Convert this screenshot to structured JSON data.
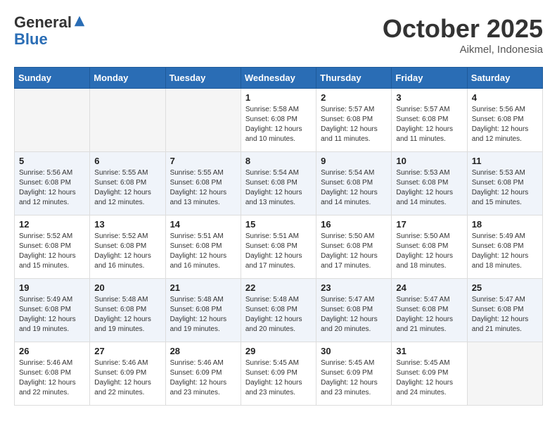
{
  "header": {
    "logo_general": "General",
    "logo_blue": "Blue",
    "month_title": "October 2025",
    "location": "Aikmel, Indonesia"
  },
  "weekdays": [
    "Sunday",
    "Monday",
    "Tuesday",
    "Wednesday",
    "Thursday",
    "Friday",
    "Saturday"
  ],
  "weeks": [
    [
      {
        "day": "",
        "info": ""
      },
      {
        "day": "",
        "info": ""
      },
      {
        "day": "",
        "info": ""
      },
      {
        "day": "1",
        "info": "Sunrise: 5:58 AM\nSunset: 6:08 PM\nDaylight: 12 hours and 10 minutes."
      },
      {
        "day": "2",
        "info": "Sunrise: 5:57 AM\nSunset: 6:08 PM\nDaylight: 12 hours and 11 minutes."
      },
      {
        "day": "3",
        "info": "Sunrise: 5:57 AM\nSunset: 6:08 PM\nDaylight: 12 hours and 11 minutes."
      },
      {
        "day": "4",
        "info": "Sunrise: 5:56 AM\nSunset: 6:08 PM\nDaylight: 12 hours and 12 minutes."
      }
    ],
    [
      {
        "day": "5",
        "info": "Sunrise: 5:56 AM\nSunset: 6:08 PM\nDaylight: 12 hours and 12 minutes."
      },
      {
        "day": "6",
        "info": "Sunrise: 5:55 AM\nSunset: 6:08 PM\nDaylight: 12 hours and 12 minutes."
      },
      {
        "day": "7",
        "info": "Sunrise: 5:55 AM\nSunset: 6:08 PM\nDaylight: 12 hours and 13 minutes."
      },
      {
        "day": "8",
        "info": "Sunrise: 5:54 AM\nSunset: 6:08 PM\nDaylight: 12 hours and 13 minutes."
      },
      {
        "day": "9",
        "info": "Sunrise: 5:54 AM\nSunset: 6:08 PM\nDaylight: 12 hours and 14 minutes."
      },
      {
        "day": "10",
        "info": "Sunrise: 5:53 AM\nSunset: 6:08 PM\nDaylight: 12 hours and 14 minutes."
      },
      {
        "day": "11",
        "info": "Sunrise: 5:53 AM\nSunset: 6:08 PM\nDaylight: 12 hours and 15 minutes."
      }
    ],
    [
      {
        "day": "12",
        "info": "Sunrise: 5:52 AM\nSunset: 6:08 PM\nDaylight: 12 hours and 15 minutes."
      },
      {
        "day": "13",
        "info": "Sunrise: 5:52 AM\nSunset: 6:08 PM\nDaylight: 12 hours and 16 minutes."
      },
      {
        "day": "14",
        "info": "Sunrise: 5:51 AM\nSunset: 6:08 PM\nDaylight: 12 hours and 16 minutes."
      },
      {
        "day": "15",
        "info": "Sunrise: 5:51 AM\nSunset: 6:08 PM\nDaylight: 12 hours and 17 minutes."
      },
      {
        "day": "16",
        "info": "Sunrise: 5:50 AM\nSunset: 6:08 PM\nDaylight: 12 hours and 17 minutes."
      },
      {
        "day": "17",
        "info": "Sunrise: 5:50 AM\nSunset: 6:08 PM\nDaylight: 12 hours and 18 minutes."
      },
      {
        "day": "18",
        "info": "Sunrise: 5:49 AM\nSunset: 6:08 PM\nDaylight: 12 hours and 18 minutes."
      }
    ],
    [
      {
        "day": "19",
        "info": "Sunrise: 5:49 AM\nSunset: 6:08 PM\nDaylight: 12 hours and 19 minutes."
      },
      {
        "day": "20",
        "info": "Sunrise: 5:48 AM\nSunset: 6:08 PM\nDaylight: 12 hours and 19 minutes."
      },
      {
        "day": "21",
        "info": "Sunrise: 5:48 AM\nSunset: 6:08 PM\nDaylight: 12 hours and 19 minutes."
      },
      {
        "day": "22",
        "info": "Sunrise: 5:48 AM\nSunset: 6:08 PM\nDaylight: 12 hours and 20 minutes."
      },
      {
        "day": "23",
        "info": "Sunrise: 5:47 AM\nSunset: 6:08 PM\nDaylight: 12 hours and 20 minutes."
      },
      {
        "day": "24",
        "info": "Sunrise: 5:47 AM\nSunset: 6:08 PM\nDaylight: 12 hours and 21 minutes."
      },
      {
        "day": "25",
        "info": "Sunrise: 5:47 AM\nSunset: 6:08 PM\nDaylight: 12 hours and 21 minutes."
      }
    ],
    [
      {
        "day": "26",
        "info": "Sunrise: 5:46 AM\nSunset: 6:08 PM\nDaylight: 12 hours and 22 minutes."
      },
      {
        "day": "27",
        "info": "Sunrise: 5:46 AM\nSunset: 6:09 PM\nDaylight: 12 hours and 22 minutes."
      },
      {
        "day": "28",
        "info": "Sunrise: 5:46 AM\nSunset: 6:09 PM\nDaylight: 12 hours and 23 minutes."
      },
      {
        "day": "29",
        "info": "Sunrise: 5:45 AM\nSunset: 6:09 PM\nDaylight: 12 hours and 23 minutes."
      },
      {
        "day": "30",
        "info": "Sunrise: 5:45 AM\nSunset: 6:09 PM\nDaylight: 12 hours and 23 minutes."
      },
      {
        "day": "31",
        "info": "Sunrise: 5:45 AM\nSunset: 6:09 PM\nDaylight: 12 hours and 24 minutes."
      },
      {
        "day": "",
        "info": ""
      }
    ]
  ]
}
